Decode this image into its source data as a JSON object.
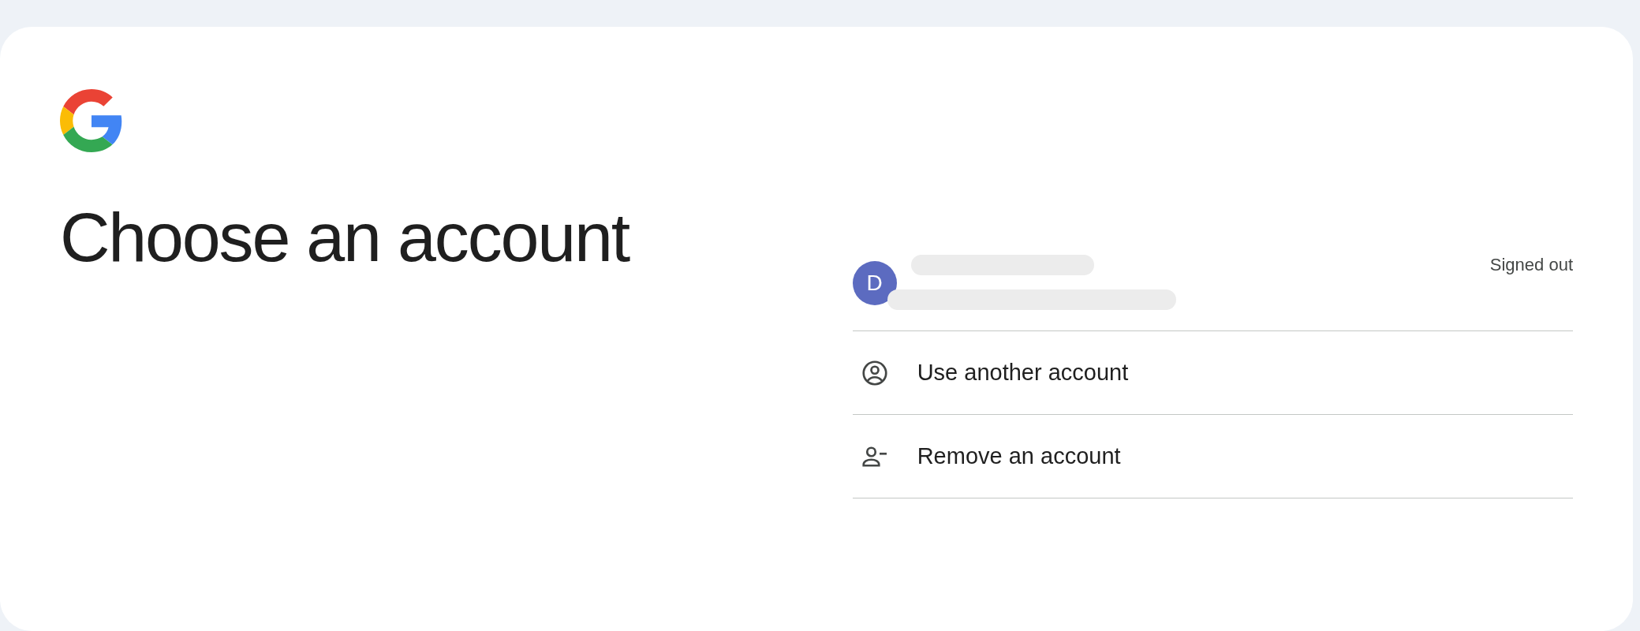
{
  "heading": "Choose an account",
  "account": {
    "avatar_letter": "D",
    "status": "Signed out"
  },
  "options": [
    {
      "kind": "add",
      "label": "Use another account"
    },
    {
      "kind": "remove",
      "label": "Remove an account"
    }
  ]
}
